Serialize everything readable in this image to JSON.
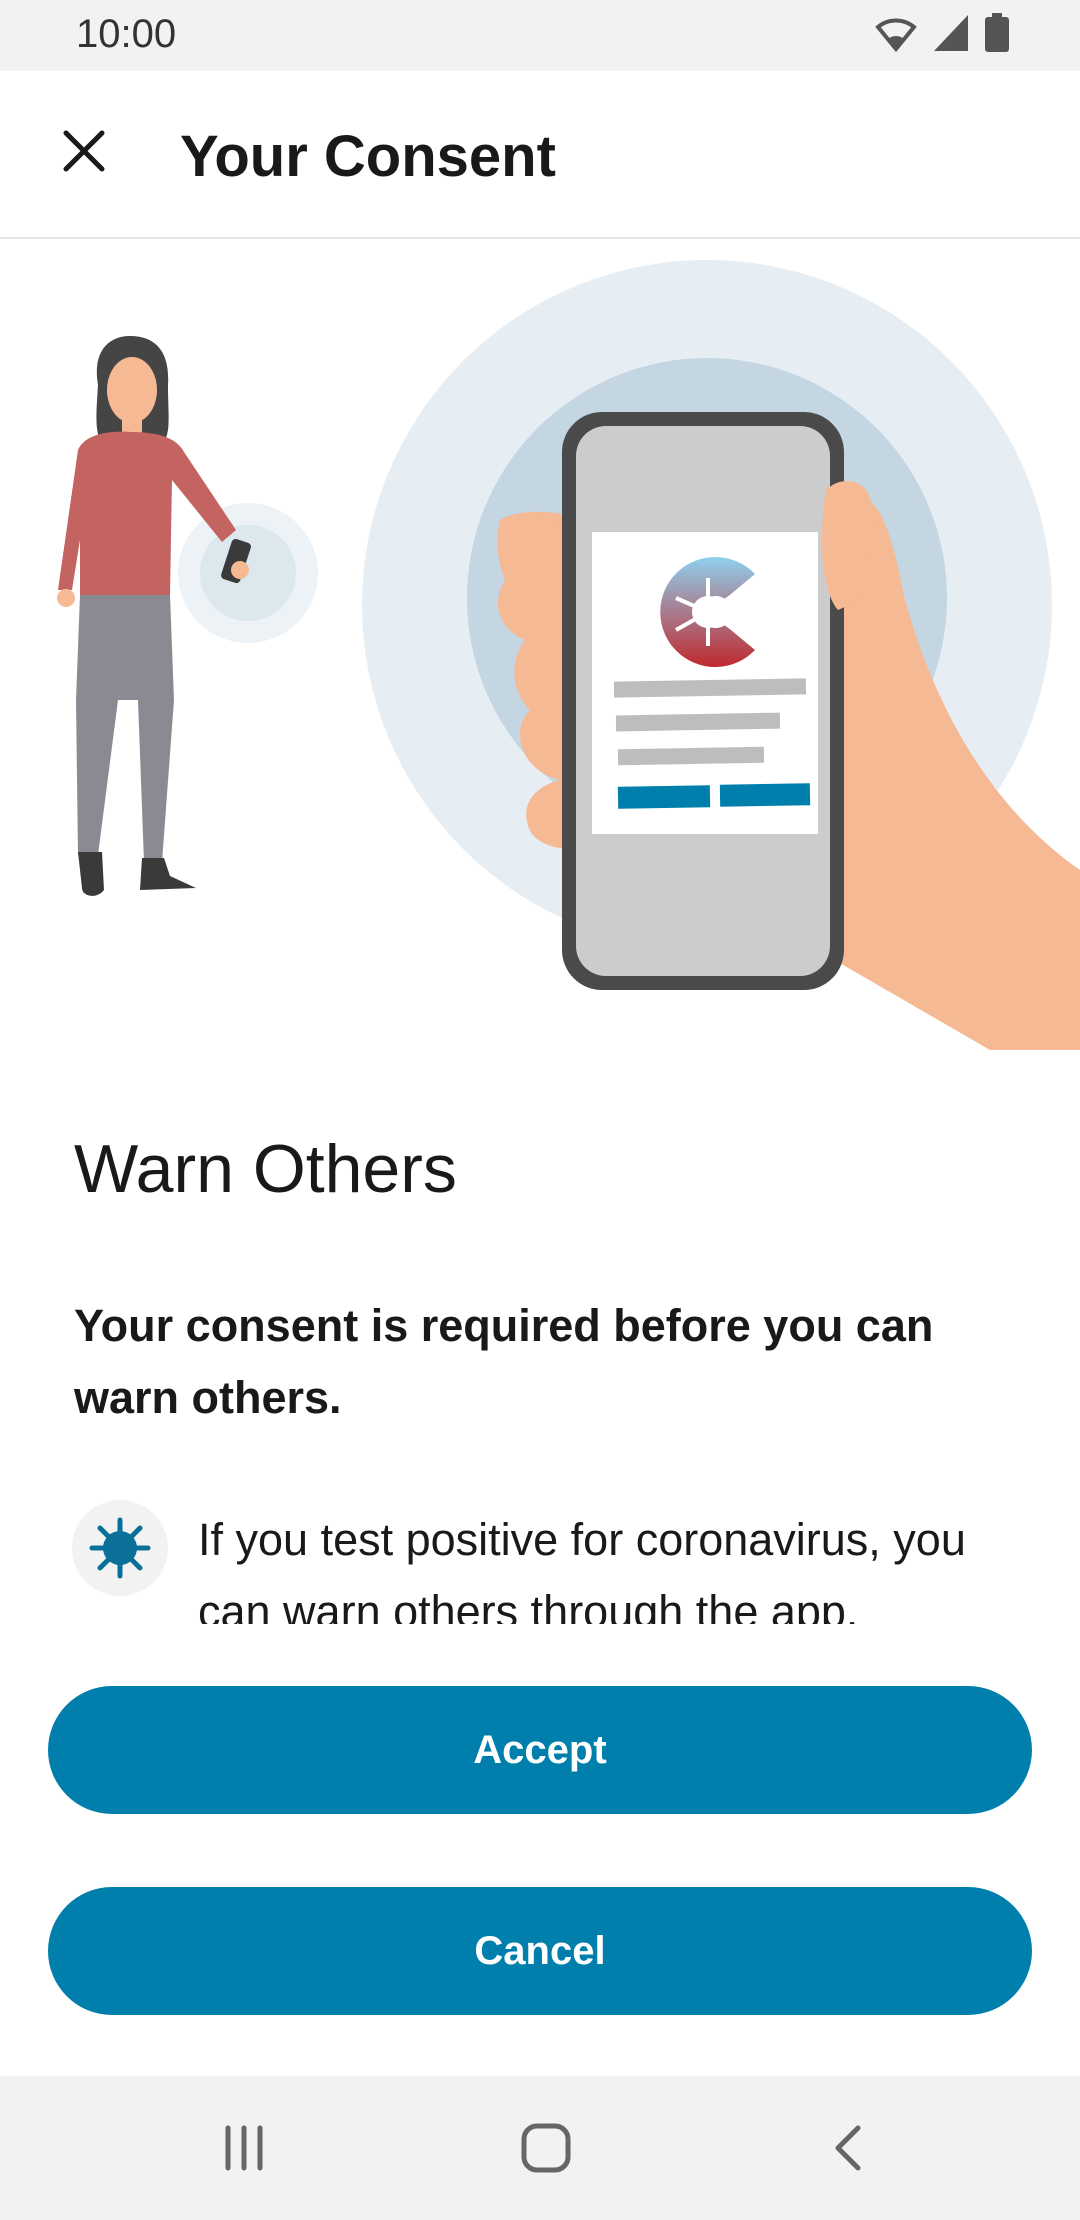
{
  "status_bar": {
    "time": "10:00",
    "icons": [
      "wifi-icon",
      "signal-icon",
      "battery-icon"
    ]
  },
  "app_bar": {
    "title": "Your Consent",
    "close_icon": "close-icon"
  },
  "content": {
    "heading": "Warn Others",
    "subheading": "Your consent is required before you can warn others.",
    "bullet": {
      "icon": "virus-icon",
      "text": "If you test positive for coronavirus, you can warn others through the app."
    }
  },
  "buttons": {
    "accept": "Accept",
    "cancel": "Cancel"
  },
  "nav_bar": {
    "icons": [
      "recent-apps-icon",
      "home-icon",
      "back-icon"
    ]
  },
  "colors": {
    "accent": "#007fad",
    "status_bar_bg": "#f2f2f2",
    "text": "#17191a"
  }
}
